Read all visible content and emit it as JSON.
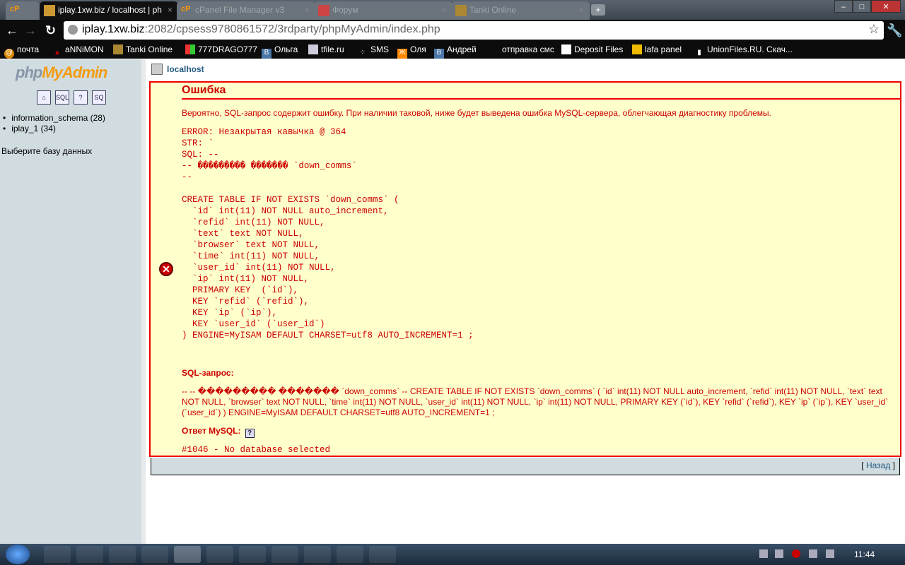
{
  "browser": {
    "tabs": [
      {
        "label": "",
        "icon": "cP"
      },
      {
        "label": "iplay.1xw.biz / localhost | ph",
        "icon": "PMA",
        "active": true
      },
      {
        "label": "cPanel File Manager v3",
        "icon": "cP"
      },
      {
        "label": "Форум",
        "icon": "forum"
      },
      {
        "label": "Tanki Online",
        "icon": "tank"
      }
    ],
    "url_host": "iplay.1xw.biz",
    "url_rest": ":2082/cpsess9780861572/3rdparty/phpMyAdmin/index.php",
    "bookmarks": [
      "почта",
      "aNNiMON",
      "Tanki Online",
      "777DRAGO777",
      "Ольга",
      "tfile.ru",
      "SMS",
      "Оля",
      "Андрей",
      "отправка смс",
      "Deposit Files",
      "lafa panel",
      "UnionFiles.RU. Скач..."
    ]
  },
  "sidebar": {
    "logo_php": "php",
    "logo_admin": "MyAdmin",
    "icons": [
      "home-icon",
      "sql-icon",
      "help-icon",
      "docs-icon"
    ],
    "databases": [
      "information_schema (28)",
      "iplay_1 (34)"
    ],
    "choose": "Выберите базу данных"
  },
  "main": {
    "server": "localhost",
    "error_title": "Ошибка",
    "intro": "Вероятно, SQL-запрос содержит ошибку. При наличии таковой, ниже будет выведена ошибка MySQL-сервера, облегчающая диагностику проблемы.",
    "error_pre": "ERROR: Незакрытая кавычка @ 364\nSTR: `\nSQL: --\n-- ��������� ������� `down_comms`\n--\n\nCREATE TABLE IF NOT EXISTS `down_comms` (\n  `id` int(11) NOT NULL auto_increment,\n  `refid` int(11) NOT NULL,\n  `text` text NOT NULL,\n  `browser` text NOT NULL,\n  `time` int(11) NOT NULL,\n  `user_id` int(11) NOT NULL,\n  `ip` int(11) NOT NULL,\n  PRIMARY KEY  (`id`),\n  KEY `refid` (`refid`),\n  KEY `ip` (`ip`),\n  KEY `user_id` (`user_id`)\n) ENGINE=MyISAM DEFAULT CHARSET=utf8 AUTO_INCREMENT=1 ;",
    "sql_label": "SQL-запрос:",
    "sql_text": "-- -- ��������� ������� `down_comms` -- CREATE TABLE IF NOT EXISTS `down_comms` ( `id` int(11) NOT NULL auto_increment, `refid` int(11) NOT NULL, `text` text NOT NULL, `browser` text NOT NULL, `time` int(11) NOT NULL, `user_id` int(11) NOT NULL, `ip` int(11) NOT NULL, PRIMARY KEY (`id`), KEY `refid` (`refid`), KEY `ip` (`ip`), KEY `user_id` (`user_id`) ) ENGINE=MyISAM DEFAULT CHARSET=utf8 AUTO_INCREMENT=1 ;",
    "mysql_label": "Ответ MySQL:",
    "mysql_help": "?",
    "mysql_response": "#1046 - No database selected",
    "back_open": "[ ",
    "back": "Назад",
    "back_close": " ]"
  },
  "taskbar": {
    "clock": "11:44"
  }
}
